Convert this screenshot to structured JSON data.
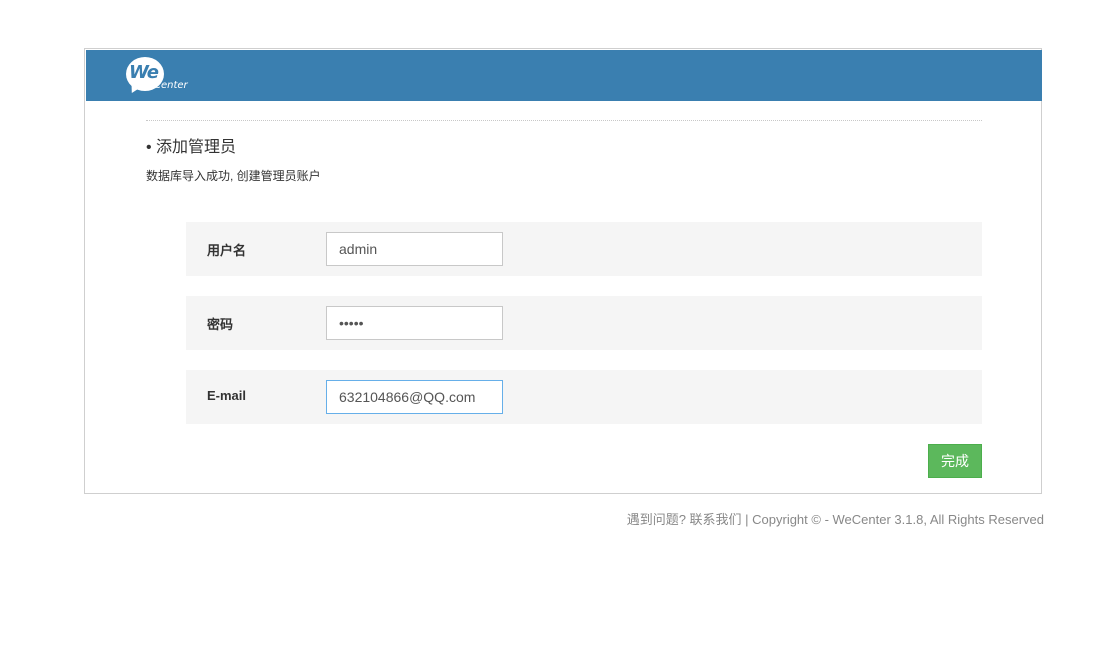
{
  "header": {
    "logo_we": "We",
    "logo_center": "Center",
    "bg_color": "#3a7fb0"
  },
  "section": {
    "title": "• 添加管理员",
    "desc": "数据库导入成功, 创建管理员账户"
  },
  "form": {
    "username_label": "用户名",
    "username_value": "admin",
    "password_label": "密码",
    "password_value": "admin",
    "email_label": "E-mail",
    "email_value": "632104866@QQ.com",
    "submit_label": "完成",
    "submit_color": "#5cb85c"
  },
  "footer": {
    "help_link": "遇到问题? 联系我们",
    "separator": " | ",
    "copyright": "Copyright © - WeCenter 3.1.8, All Rights Reserved"
  }
}
